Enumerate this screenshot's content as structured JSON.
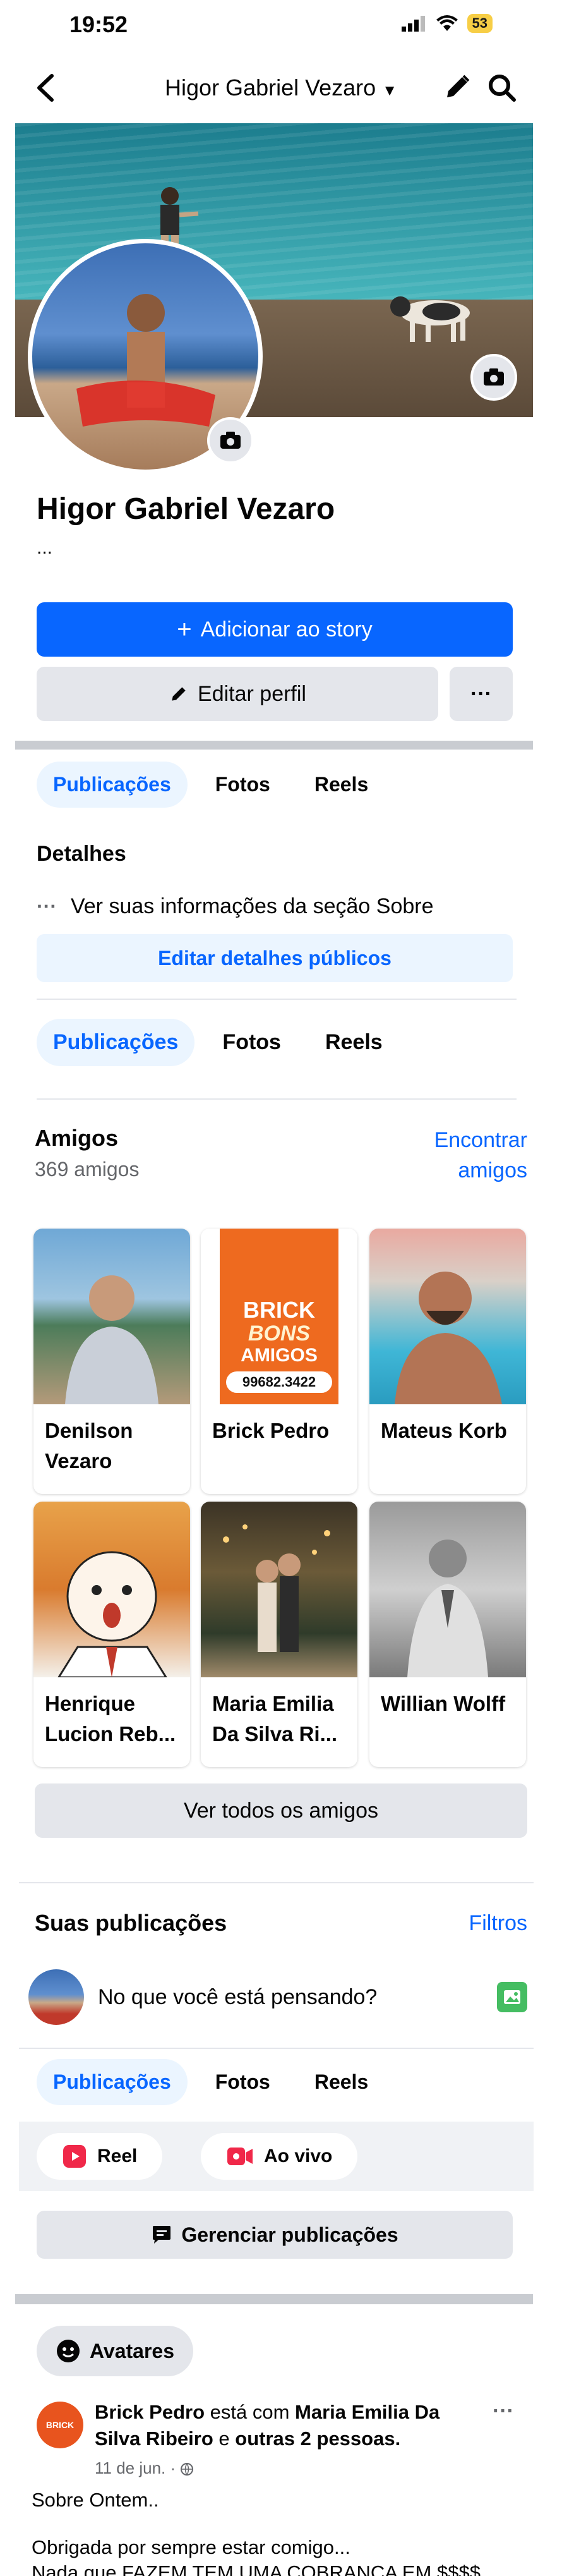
{
  "status_bar": {
    "time": "19:52",
    "battery": "53"
  },
  "nav": {
    "title": "Higor Gabriel Vezaro"
  },
  "profile": {
    "name": "Higor Gabriel Vezaro",
    "bio": "...",
    "add_story": "Adicionar ao story",
    "edit_profile": "Editar perfil",
    "more": "···"
  },
  "tabs_top": [
    "Publicações",
    "Fotos",
    "Reels"
  ],
  "details": {
    "title": "Detalhes",
    "see_about": "Ver suas informações da seção Sobre",
    "edit_public": "Editar detalhes públicos"
  },
  "tabs_mid": [
    "Publicações",
    "Fotos",
    "Reels"
  ],
  "friends": {
    "title": "Amigos",
    "count": "369 amigos",
    "find_line1": "Encontrar",
    "find_line2": "amigos",
    "list": [
      {
        "name": "Denilson Vezaro"
      },
      {
        "name": "Brick Pedro"
      },
      {
        "name": "Mateus Korb"
      },
      {
        "name": "Henrique Lucion Reb..."
      },
      {
        "name": "Maria Emilia Da Silva Ri..."
      },
      {
        "name": "Willian Wolff"
      }
    ],
    "brick_logo": {
      "line1": "BRICK",
      "line2": "BONS",
      "line3": "AMIGOS",
      "phone": "99682.3422"
    },
    "see_all": "Ver todos os amigos"
  },
  "posts": {
    "title": "Suas publicações",
    "filters": "Filtros",
    "composer_placeholder": "No que você está pensando?",
    "tabs": [
      "Publicações",
      "Fotos",
      "Reels"
    ],
    "reel": "Reel",
    "live": "Ao vivo",
    "manage": "Gerenciar publicações",
    "avatars": "Avatares"
  },
  "post": {
    "author": "Brick Pedro",
    "with_text": "está com",
    "tagged": "Maria Emilia Da Silva Ribeiro",
    "and_text": "e",
    "others": "outras 2 pessoas.",
    "date": "11 de jun. ·",
    "line1": "Sobre Ontem..",
    "line2": "Obrigada por sempre estar comigo...",
    "line3": "Nada que FAZEM TEM UMA COBRANCA EM $$$$ .."
  },
  "colors": {
    "accent": "#0866ff",
    "accent_light": "#ebf5ff",
    "button_gray": "#e4e6eb",
    "text_muted": "#65676b"
  }
}
